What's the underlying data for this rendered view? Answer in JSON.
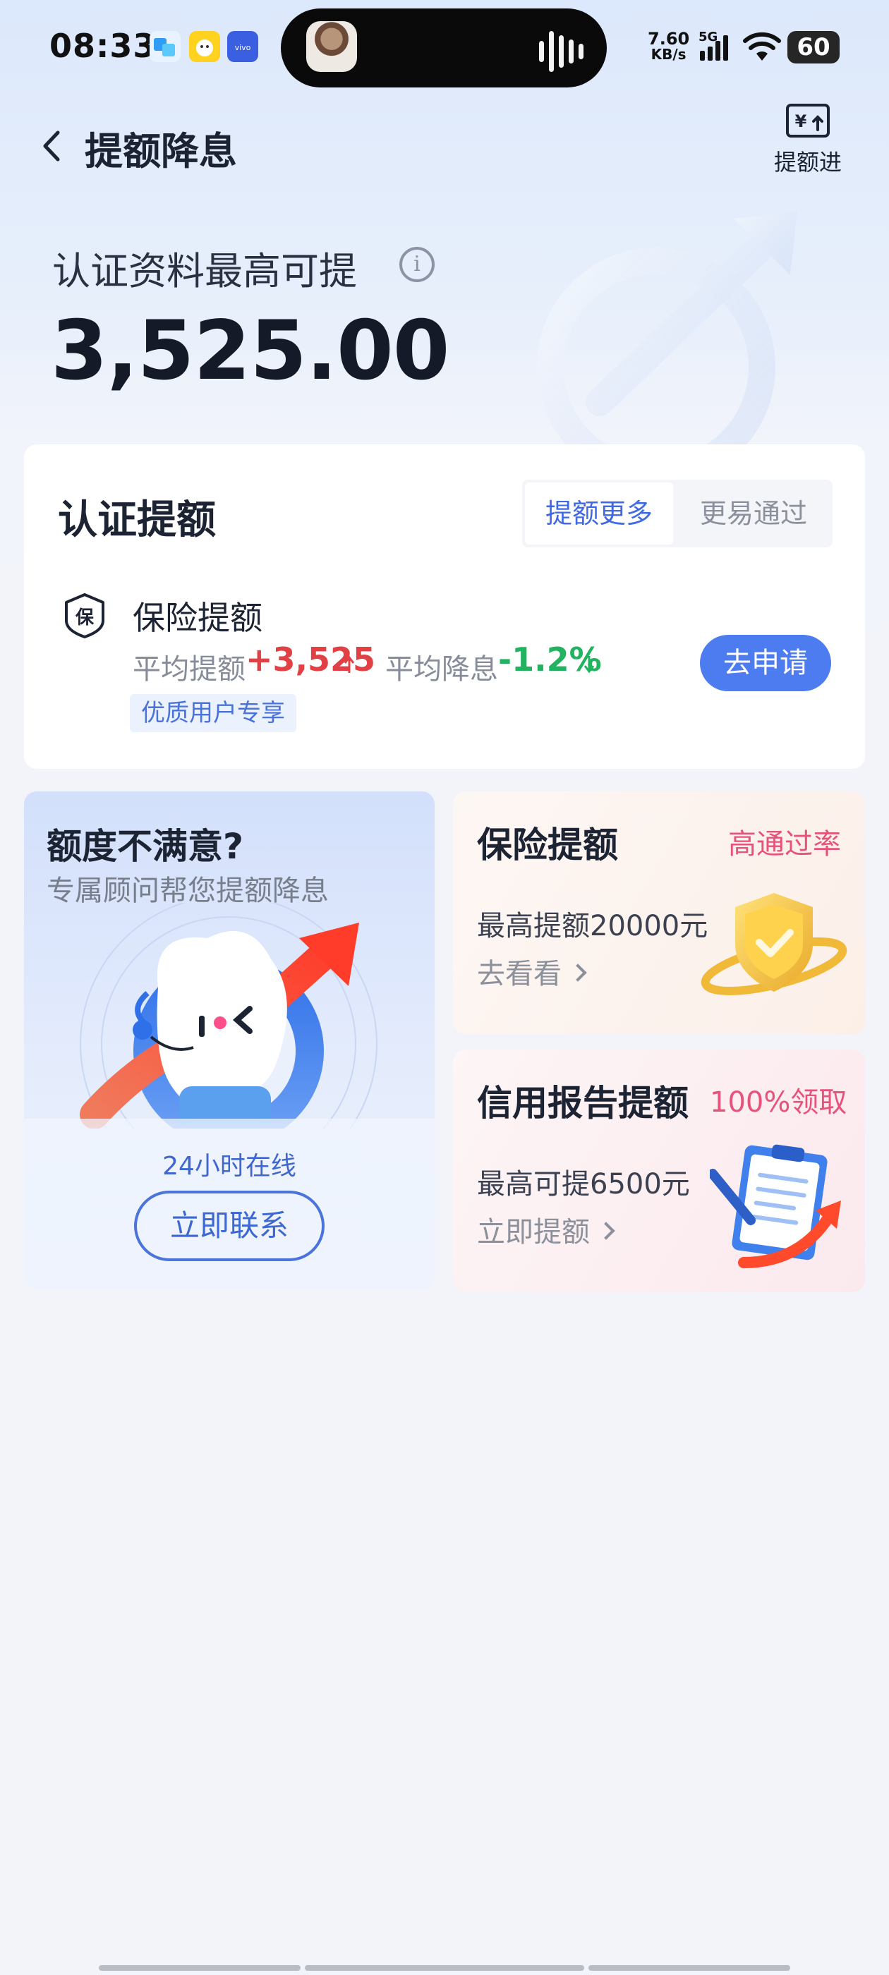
{
  "status_bar": {
    "time": "08:33",
    "apps": [
      "blue-app-icon",
      "yellow-app-icon",
      "vivo-app-icon"
    ],
    "speed_value": "7.60",
    "speed_unit": "KB/s",
    "network": "5G",
    "battery": "60"
  },
  "header": {
    "back_icon": "chevron-left-icon",
    "title": "提额降息",
    "progress_label": "提额进度",
    "progress_icon": "yen-upload-icon"
  },
  "hero": {
    "label": "认证资料最高可提",
    "amount": "3,525.00"
  },
  "cert_card": {
    "title": "认证提额",
    "tabs": [
      {
        "label": "提额更多",
        "active": true
      },
      {
        "label": "更易通过",
        "active": false
      }
    ],
    "item": {
      "icon_char": "保",
      "title": "保险提额",
      "avg_raise_label": "平均提额",
      "avg_raise_value": "+3,525",
      "avg_cut_label": "平均降息",
      "avg_cut_value": "-1.2%",
      "tag": "优质用户专享",
      "apply_label": "去申请"
    }
  },
  "advisor_card": {
    "title": "额度不满意?",
    "subtitle": "专属顾问帮您提额降息",
    "online": "24小时在线",
    "contact_label": "立即联系"
  },
  "insurance_card": {
    "title": "保险提额",
    "badge": "高通过率",
    "line": "最高提额20000元",
    "link": "去看看"
  },
  "report_card": {
    "title": "信用报告提额",
    "badge": "100%领取",
    "line": "最高可提6500元",
    "link": "立即提额"
  },
  "colors": {
    "accent": "#4d7cf0",
    "up_red": "#e14044",
    "down_green": "#21b35f",
    "badge_pink": "#e7527a"
  }
}
